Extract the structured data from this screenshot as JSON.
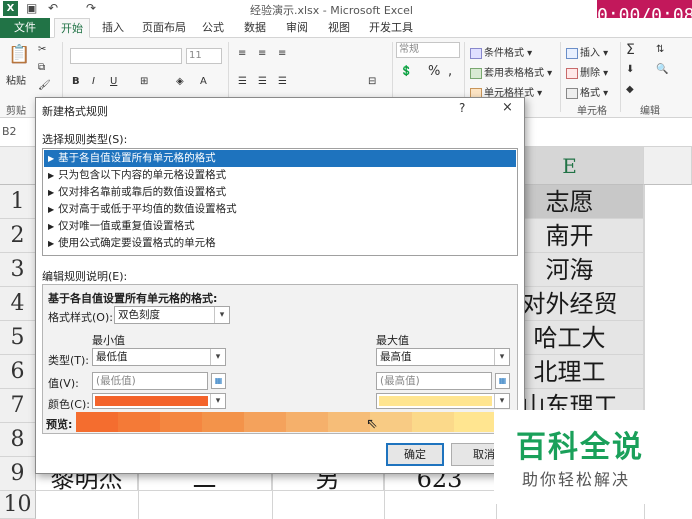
{
  "window": {
    "title": "经验演示.xlsx - Microsoft Excel",
    "timer": "0:00/0:08"
  },
  "tabs": [
    {
      "label": "文件"
    },
    {
      "label": "开始"
    },
    {
      "label": "插入"
    },
    {
      "label": "页面布局"
    },
    {
      "label": "公式"
    },
    {
      "label": "数据"
    },
    {
      "label": "审阅"
    },
    {
      "label": "视图"
    },
    {
      "label": "开发工具"
    }
  ],
  "ribbon": {
    "paste": "粘贴",
    "clipboard": "剪贴",
    "font_size": "11",
    "number_format": "常规",
    "percent": "%",
    "comma": ",",
    "cond_format": "条件格式",
    "table_format": "套用表格格式",
    "cell_style": "单元格样式",
    "insert": "插入",
    "delete": "删除",
    "format": "格式",
    "cells_group": "单元格",
    "edit_group": "编辑",
    "sum": "Σ"
  },
  "name_box": "B2",
  "sheet": {
    "col_e": "E",
    "rows": [
      "1",
      "2",
      "3",
      "4",
      "5",
      "6",
      "7",
      "8",
      "9",
      "10"
    ],
    "e_values": [
      "志愿",
      "南开",
      "河海",
      "对外经贸",
      "哈工大",
      "北理工",
      "山东理工"
    ],
    "row9": [
      "黎明杰",
      "二",
      "另",
      "623"
    ]
  },
  "dialog": {
    "title": "新建格式规则",
    "help": "?",
    "close": "×",
    "select_rule_type": "选择规则类型(S):",
    "rule_types": [
      "基于各自值设置所有单元格的格式",
      "只为包含以下内容的单元格设置格式",
      "仅对排名靠前或靠后的数值设置格式",
      "仅对高于或低于平均值的数值设置格式",
      "仅对唯一值或重复值设置格式",
      "使用公式确定要设置格式的单元格"
    ],
    "edit_rule_desc": "编辑规则说明(E):",
    "desc_heading": "基于各自值设置所有单元格的格式:",
    "format_style_label": "格式样式(O):",
    "format_style_value": "双色刻度",
    "min_header": "最小值",
    "max_header": "最大值",
    "type_label": "类型(T):",
    "value_label": "值(V):",
    "color_label": "颜色(C):",
    "min_type": "最低值",
    "max_type": "最高值",
    "min_value_ph": "(最低值)",
    "max_value_ph": "(最高值)",
    "preview_label": "预览:",
    "ok": "确定",
    "cancel": "取消"
  },
  "colors": {
    "min_color": "#f4632a",
    "max_color": "#ffe590",
    "preview": [
      "#f46d2f",
      "#f47a37",
      "#f48640",
      "#f3934a",
      "#f4a25c",
      "#f5b06b",
      "#f6bd78",
      "#f8cb84",
      "#fbd98a",
      "#ffe590"
    ]
  },
  "watermark": {
    "main": "百科全说",
    "sub": "助你轻松解决"
  }
}
